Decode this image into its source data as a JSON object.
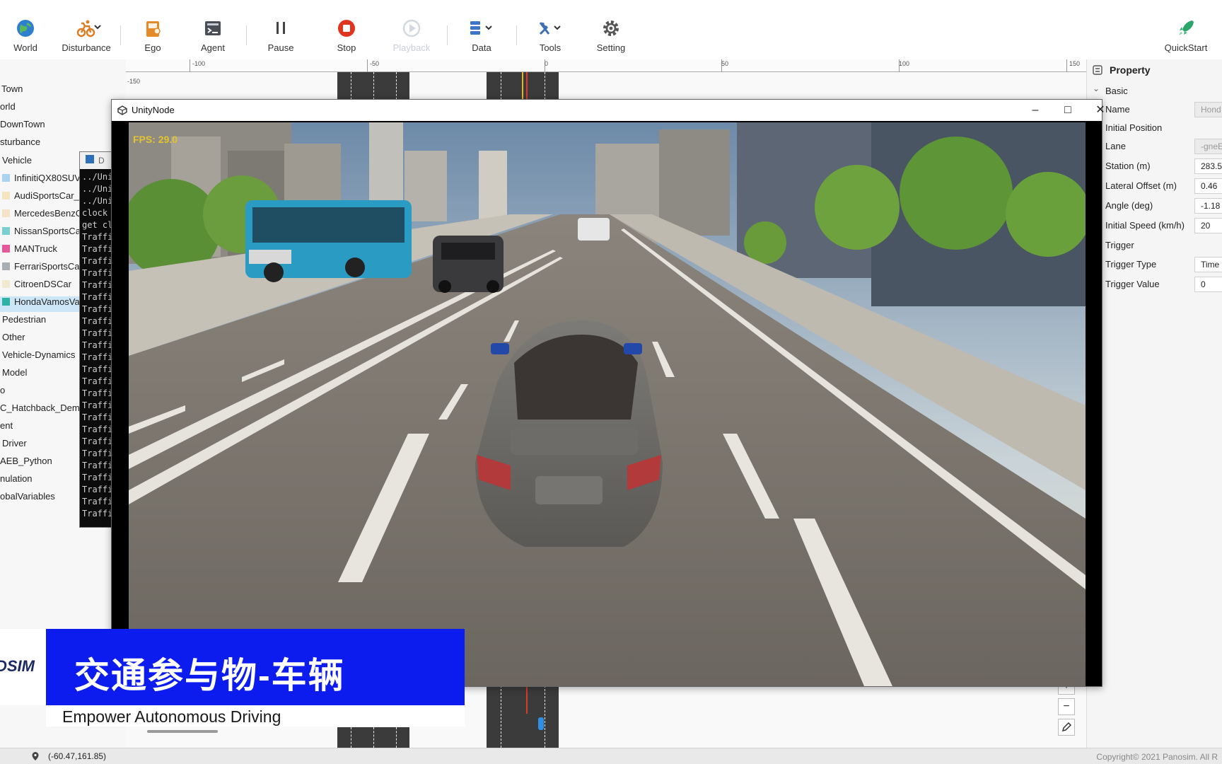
{
  "toolbar": {
    "world": "World",
    "disturbance": "Disturbance",
    "ego": "Ego",
    "agent": "Agent",
    "pause": "Pause",
    "stop": "Stop",
    "playback": "Playback",
    "data": "Data",
    "tools": "Tools",
    "setting": "Setting",
    "quickstart": "QuickStart"
  },
  "tree": {
    "items": [
      {
        "label": "Town"
      },
      {
        "label": "orld"
      },
      {
        "label": "DownTown"
      },
      {
        "label": "sturbance"
      },
      {
        "label": "Vehicle"
      },
      {
        "label": "InfinitiQX80SUV",
        "color": "#a9d3ee"
      },
      {
        "label": "AudiSportsCar_b",
        "color": "#f4e4bf"
      },
      {
        "label": "MercedesBenzCl",
        "color": "#f6e3c7"
      },
      {
        "label": "NissanSportsCar",
        "color": "#7ccfd1"
      },
      {
        "label": "MANTruck",
        "color": "#e5589a"
      },
      {
        "label": "FerrariSportsCar",
        "color": "#a9aeb4"
      },
      {
        "label": "CitroenDSCar",
        "color": "#f1ead1"
      },
      {
        "label": "HondaVamosVa",
        "color": "#2eb1a7"
      },
      {
        "label": "Pedestrian"
      },
      {
        "label": "Other"
      },
      {
        "label": "Vehicle-Dynamics"
      },
      {
        "label": "Model"
      },
      {
        "label": "o"
      },
      {
        "label": "C_Hatchback_Demo"
      },
      {
        "label": "ent"
      },
      {
        "label": "Driver"
      },
      {
        "label": "AEB_Python"
      },
      {
        "label": "nulation"
      },
      {
        "label": "obalVariables"
      }
    ]
  },
  "ruler": {
    "ticks": [
      "-150",
      "-100",
      "-50",
      "0",
      "50",
      "100",
      "150"
    ],
    "v_label": "-150"
  },
  "property": {
    "title": "Property",
    "section": "Basic",
    "fields": [
      {
        "key": "Name",
        "value": "Hond"
      },
      {
        "key": "Initial Position",
        "value": ""
      },
      {
        "key": "Lane",
        "value": "-gneE"
      },
      {
        "key": "Station (m)",
        "value": "283.5"
      },
      {
        "key": "Lateral Offset (m)",
        "value": "0.46"
      },
      {
        "key": "Angle (deg)",
        "value": "-1.18"
      },
      {
        "key": "Initial Speed (km/h)",
        "value": "20"
      },
      {
        "key": "Trigger",
        "value": ""
      },
      {
        "key": "Trigger Type",
        "value": "Time"
      },
      {
        "key": "Trigger Value",
        "value": "0"
      }
    ]
  },
  "console": {
    "title": "D",
    "lines": [
      "../Uni",
      "../Uni",
      "../Uni",
      "clock",
      "get cl",
      "Traffi",
      "Traffi",
      "Traffi",
      "Traffi",
      "Traffi",
      "Traffi",
      "Traffi",
      "Traffi",
      "Traffi",
      "Traffi",
      "Traffi",
      "Traffi",
      "Traffi",
      "Traffi",
      "Traffi",
      "Traffi",
      "Traffi",
      "Traffi",
      "Traffi",
      "Traffi",
      "Traffi",
      "Traffi",
      "Traffi",
      "Traffi"
    ]
  },
  "unity": {
    "title": "UnityNode",
    "fps": "FPS: 29.0"
  },
  "zoom": {
    "plus": "+",
    "minus": "−"
  },
  "banner": {
    "title": "交通参与物-车辆",
    "subtitle": "Empower Autonomous Driving",
    "logo": "DSIM"
  },
  "status": {
    "coordinates": "(-60.47,161.85)",
    "copyright": "Copyright© 2021 Panosim. All R"
  },
  "colors": {
    "banner": "#0d1cee",
    "selection": "#cde6f7",
    "stop_red": "#e0341f",
    "quickstart_green": "#2aa66a"
  }
}
